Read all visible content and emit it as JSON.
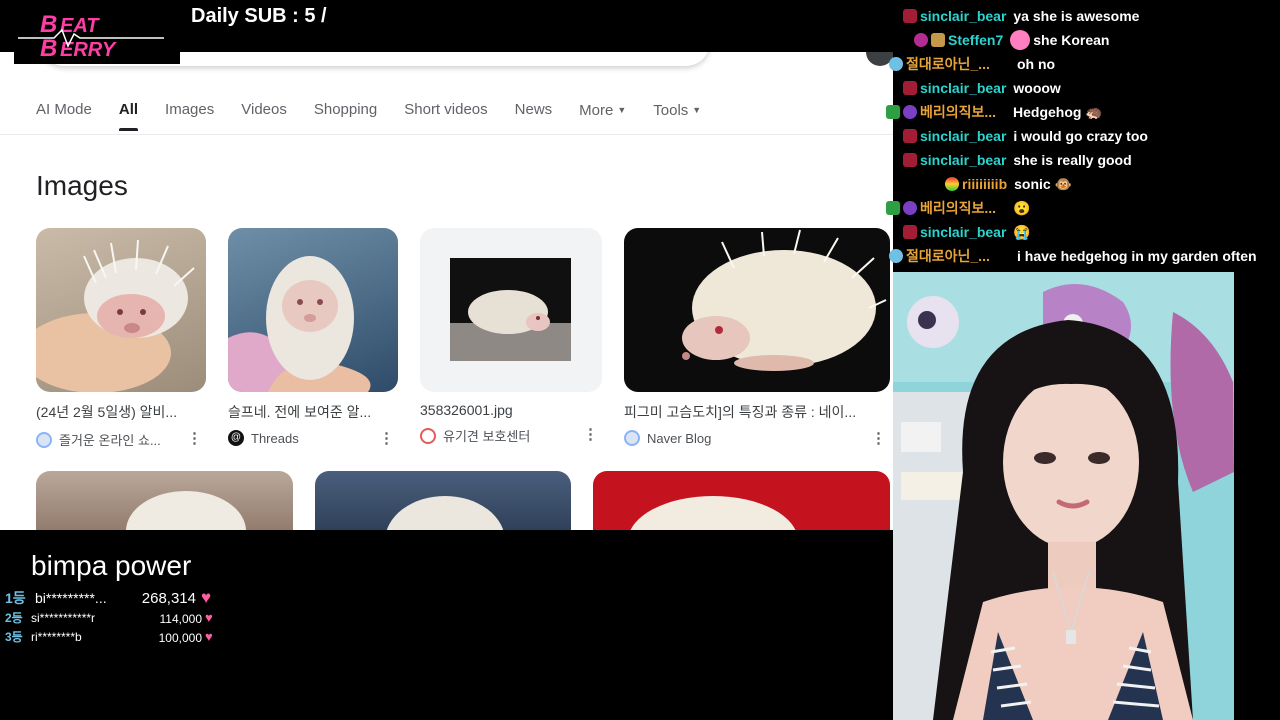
{
  "overlay": {
    "logo_text_top": "BEAT",
    "logo_text_bottom": "BERRY",
    "daily_sub": "Daily SUB : 5 /"
  },
  "google": {
    "tabs": [
      {
        "label": "AI Mode"
      },
      {
        "label": "All"
      },
      {
        "label": "Images"
      },
      {
        "label": "Videos"
      },
      {
        "label": "Shopping"
      },
      {
        "label": "Short videos"
      },
      {
        "label": "News"
      },
      {
        "label": "More"
      },
      {
        "label": "Tools"
      }
    ],
    "section_title": "Images",
    "results": [
      {
        "title": "(24년 2월 5일생) 알비...",
        "source": "즐거운 온라인 쇼..."
      },
      {
        "title": "슬프네. 전에 보여준 알...",
        "source": "Threads"
      },
      {
        "title": "358326001.jpg",
        "source": "유기견 보호센터"
      },
      {
        "title": "피그미 고슴도치]의 특징과 종류 : 네이...",
        "source": "Naver Blog"
      }
    ]
  },
  "ranking": {
    "title": "bimpa power",
    "entries": [
      {
        "rank": "1등",
        "name": "bi*********...",
        "amount": "268,314"
      },
      {
        "rank": "2등",
        "name": "si***********r",
        "amount": "114,000"
      },
      {
        "rank": "3등",
        "name": "ri********b",
        "amount": "100,000"
      }
    ]
  },
  "chat": [
    {
      "user": "sinclair_bear",
      "message": "ya she is awesome",
      "color": "#2bd4cf"
    },
    {
      "user": "Steffen7",
      "message": "she Korean",
      "color": "#2bd4cf"
    },
    {
      "user": "절대로아닌_...",
      "message": "oh no",
      "color": "#e8a33a"
    },
    {
      "user": "sinclair_bear",
      "message": "wooow",
      "color": "#2bd4cf"
    },
    {
      "user": "베리의직보...",
      "message": "Hedgehog 🦔",
      "color": "#e8a33a"
    },
    {
      "user": "sinclair_bear",
      "message": "i would go crazy too",
      "color": "#2bd4cf"
    },
    {
      "user": "sinclair_bear",
      "message": "she is really good",
      "color": "#2bd4cf"
    },
    {
      "user": "riiiiiiiib",
      "message": "sonic 🐵",
      "color": "#e8a33a"
    },
    {
      "user": "베리의직보...",
      "message": "😮",
      "color": "#e8a33a"
    },
    {
      "user": "sinclair_bear",
      "message": "😭",
      "color": "#2bd4cf"
    },
    {
      "user": "절대로아닌_...",
      "message": "i have hedgehog in my garden often",
      "color": "#e8a33a"
    }
  ],
  "heart_glyph": "♥",
  "dots_glyph": "⋮"
}
